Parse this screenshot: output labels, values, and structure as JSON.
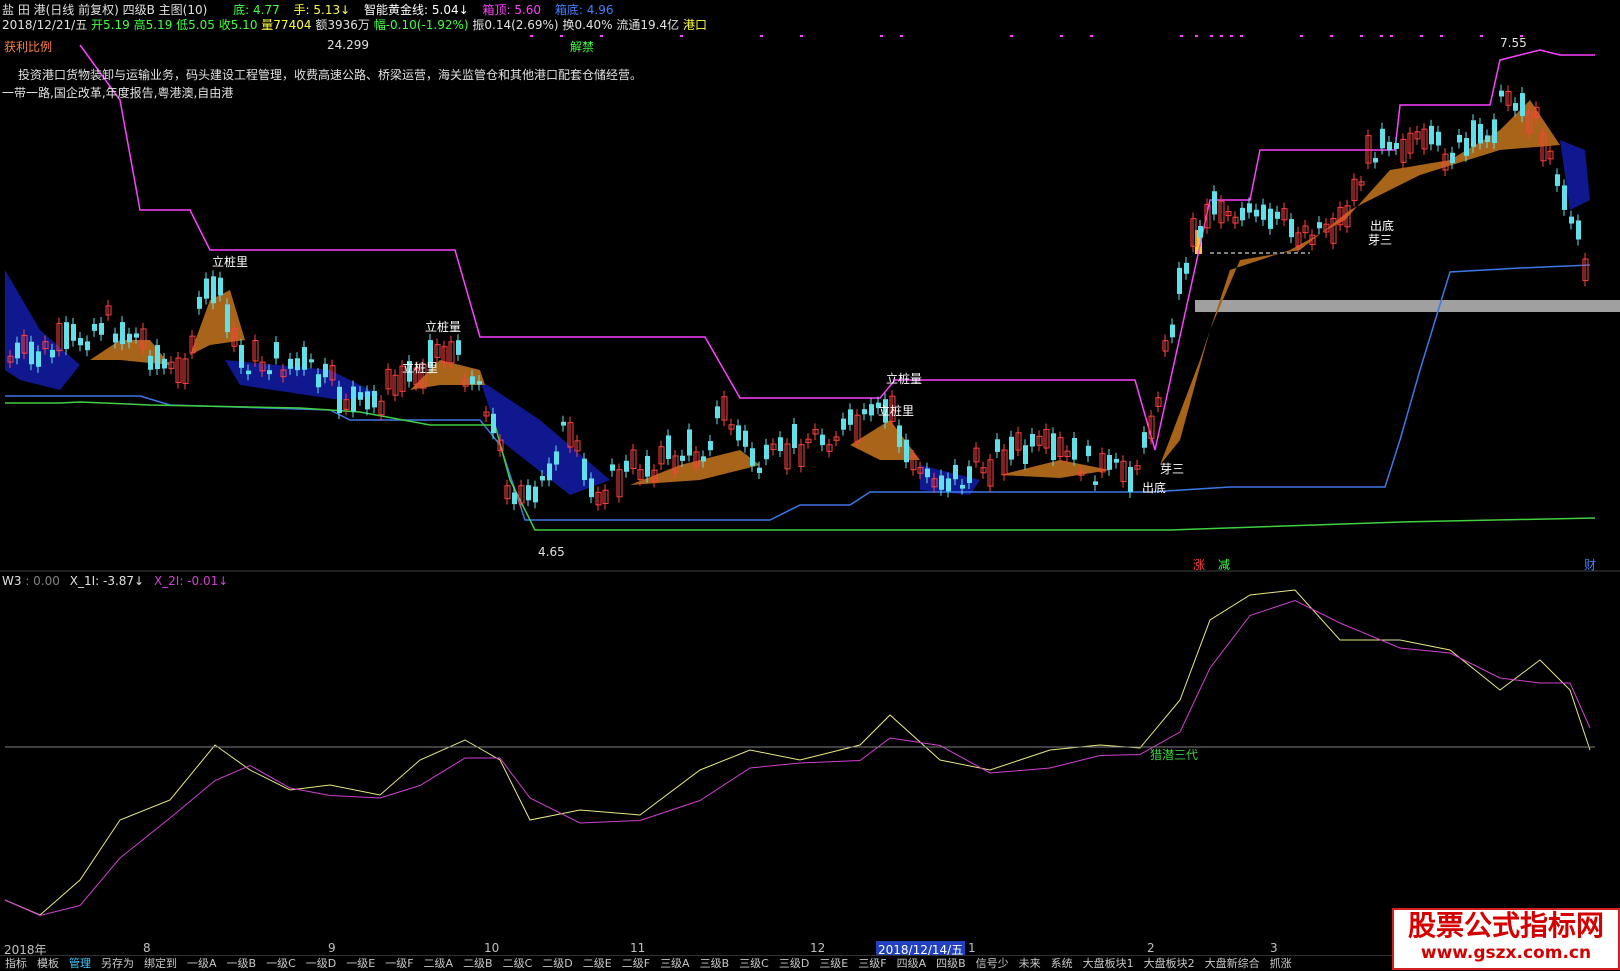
{
  "header": {
    "title": "盐 田 港(日线 前复权) 四级B 主图(10)",
    "bottom_label": "底: 4.77",
    "hand_label": "手: 5.13",
    "gold_line_label": "智能黄金线: 5.04",
    "box_top_label": "箱顶: 5.60",
    "box_bottom_label": "箱底: 4.96",
    "row2_date": "2018/12/21/五",
    "row2_open": "开5.19",
    "row2_high": "高5.19",
    "row2_low": "低5.05",
    "row2_close": "收5.10",
    "row2_volume": "量77404",
    "row2_amount": "额3936万",
    "row2_change": "幅-0.10(-1.92%)",
    "row2_amplitude": "振0.14(2.69%)",
    "row2_turnover": "换0.40%",
    "row2_float": "流通19.4亿",
    "row2_industry": "港口"
  },
  "info": {
    "profit_ratio_label": "获利比例",
    "profit_ratio_value": "24.299",
    "lift_ban": "解禁",
    "business": "投资港口货物装卸与运输业务，码头建设工程管理，收费高速公路、桥梁运营，海关监管仓和其他港口配套仓储经营。",
    "concepts": "一带一路,国企改革,年度报告,粤港澳,自由港"
  },
  "chart_marks": {
    "price_high": "7.55",
    "price_low": "4.65",
    "zhuang": "立桩里",
    "zhuang2": "立桩量",
    "chudi": "出底",
    "yasan": "芽三",
    "zhang": "涨",
    "jian": "减",
    "cai": "财"
  },
  "lower_panel": {
    "w3_label": "W3",
    "w3_value": ": 0.00",
    "x1_label": "X_1I: -3.87",
    "x2_label": "X_2I: -0.01",
    "annotation": "猎潜三代"
  },
  "xaxis": {
    "year": "2018年",
    "months": [
      "8",
      "9",
      "10",
      "11",
      "12",
      "1",
      "2",
      "3"
    ],
    "cursor_date": "2018/12/14/五"
  },
  "taskbar": {
    "items": [
      "指标",
      "模板",
      "管理",
      "另存为",
      "绑定到",
      "一级A",
      "一级B",
      "一级C",
      "一级D",
      "一级E",
      "一级F",
      "二级A",
      "二级B",
      "二级C",
      "二级D",
      "二级E",
      "二级F",
      "三级A",
      "三级B",
      "三级C",
      "三级D",
      "三级E",
      "三级F",
      "四级A",
      "四级B",
      "信号少",
      "未来",
      "系统",
      "大盘板块1",
      "大盘板块2",
      "大盘新综合",
      "抓涨"
    ],
    "active_index": 2
  },
  "watermark": {
    "line1": "股票公式指标网",
    "line2": "www.gszx.com.cn"
  },
  "colors": {
    "magenta_line": "#ff40ff",
    "blue_line": "#3c78e6",
    "green_line": "#40d040",
    "up_candle": "#ff4040",
    "down_candle": "#60e0e8",
    "brown_fill": "#a86418",
    "navy_fill": "#101890",
    "yellow_osc": "#e8e880",
    "magenta_osc": "#d040d0"
  }
}
